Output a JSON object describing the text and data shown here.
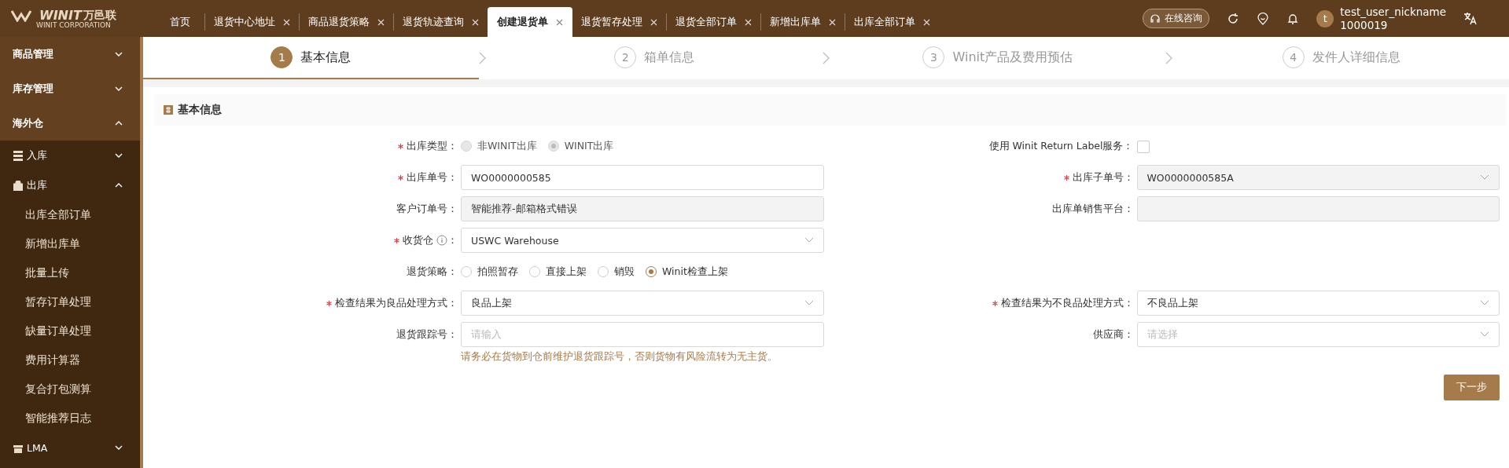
{
  "logo": {
    "mark": "WINIT",
    "name": "万邑联",
    "sub": "WINIT CORPORATION"
  },
  "tabs": [
    {
      "label": "首页",
      "closable": false,
      "selected": false
    },
    {
      "label": "退货中心地址",
      "closable": true,
      "selected": false
    },
    {
      "label": "商品退货策略",
      "closable": true,
      "selected": false
    },
    {
      "label": "退货轨迹查询",
      "closable": true,
      "selected": false
    },
    {
      "label": "创建退货单",
      "closable": true,
      "selected": true
    },
    {
      "label": "退货暂存处理",
      "closable": true,
      "selected": false
    },
    {
      "label": "退货全部订单",
      "closable": true,
      "selected": false
    },
    {
      "label": "新增出库单",
      "closable": true,
      "selected": false
    },
    {
      "label": "出库全部订单",
      "closable": true,
      "selected": false
    }
  ],
  "header": {
    "consult": "在线咨询",
    "avatar": "t",
    "username": "test_user_nickname",
    "user_id": "1000019"
  },
  "sidebar": {
    "items": [
      {
        "label": "商品管理",
        "expanded": false
      },
      {
        "label": "库存管理",
        "expanded": false
      },
      {
        "label": "海外仓",
        "expanded": true,
        "children": [
          {
            "label": "入库",
            "expanded": false
          },
          {
            "label": "出库",
            "expanded": true,
            "children": [
              {
                "label": "出库全部订单"
              },
              {
                "label": "新增出库单"
              },
              {
                "label": "批量上传"
              },
              {
                "label": "暂存订单处理"
              },
              {
                "label": "缺量订单处理"
              },
              {
                "label": "费用计算器"
              },
              {
                "label": "复合打包测算"
              },
              {
                "label": "智能推荐日志"
              }
            ]
          },
          {
            "label": "LMA",
            "expanded": false
          }
        ]
      }
    ]
  },
  "steps": [
    {
      "number": "1",
      "label": "基本信息",
      "selected": true
    },
    {
      "number": "2",
      "label": "箱单信息",
      "selected": false
    },
    {
      "number": "3",
      "label": "Winit产品及费用预估",
      "selected": false
    },
    {
      "number": "4",
      "label": "发件人详细信息",
      "selected": false
    }
  ],
  "section": {
    "title": "基本信息"
  },
  "rows": [
    {
      "left": {
        "kind": "radio",
        "label": "出库类型：",
        "required": true,
        "disabled": true,
        "options": [
          {
            "label": "非WINIT出库",
            "selected": false
          },
          {
            "label": "WINIT出库",
            "selected": true
          }
        ]
      },
      "right": {
        "kind": "checkbox",
        "label": "使用 Winit Return Label服务：",
        "required": false,
        "checked": false
      }
    },
    {
      "left": {
        "kind": "input",
        "label": "出库单号：",
        "required": true,
        "disabled": false,
        "value": "WO0000000585"
      },
      "right": {
        "kind": "select",
        "label": "出库子单号：",
        "required": true,
        "disabled": true,
        "value": "WO0000000585A"
      }
    },
    {
      "left": {
        "kind": "input",
        "label": "客户订单号：",
        "required": false,
        "disabled": true,
        "value": "智能推荐-邮箱格式错误"
      },
      "right": {
        "kind": "input",
        "label": "出库单销售平台：",
        "required": false,
        "disabled": true
      }
    },
    {
      "left": {
        "kind": "select",
        "label": "收货仓",
        "label_end": "：",
        "required": true,
        "disabled": false,
        "value": "USWC Warehouse"
      }
    },
    {
      "left": {
        "kind": "radio",
        "label": "退货策略：",
        "required": false,
        "disabled": false,
        "options": [
          {
            "label": "拍照暂存",
            "selected": false
          },
          {
            "label": "直接上架",
            "selected": false
          },
          {
            "label": "销毁",
            "selected": false
          },
          {
            "label": "Winit检查上架",
            "selected": true
          }
        ]
      }
    },
    {
      "left": {
        "kind": "select",
        "label": "检查结果为良品处理方式：",
        "required": true,
        "disabled": false,
        "value": "良品上架"
      },
      "right": {
        "kind": "select",
        "label": "检查结果为不良品处理方式：",
        "required": true,
        "disabled": false,
        "value": "不良品上架"
      }
    },
    {
      "left": {
        "kind": "input",
        "label": "退货跟踪号：",
        "required": false,
        "disabled": false,
        "placeholder": "请输入",
        "hint": "请务必在货物到仓前维护退货跟踪号，否则货物有风险流转为无主货。"
      },
      "right": {
        "kind": "select",
        "label": "供应商：",
        "required": false,
        "disabled": false,
        "placeholder": "请选择"
      }
    }
  ],
  "next_button": "下一步"
}
